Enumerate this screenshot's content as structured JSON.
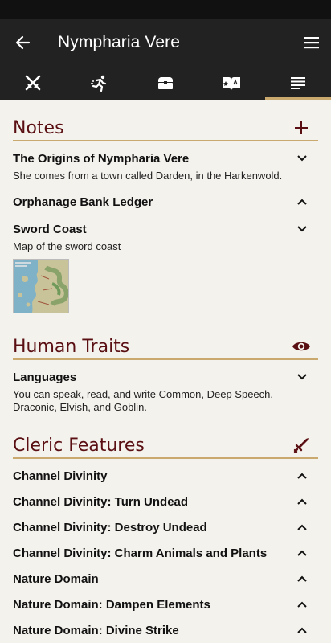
{
  "header": {
    "title": "Nympharia Vere"
  },
  "tabs": [
    {
      "icon": "crossed-swords-icon"
    },
    {
      "icon": "running-person-icon"
    },
    {
      "icon": "treasure-chest-icon"
    },
    {
      "icon": "spellbook-icon"
    },
    {
      "icon": "notes-lines-icon",
      "active": true
    }
  ],
  "notes": {
    "title": "Notes",
    "items": [
      {
        "title": "The Origins of Nympharia Vere",
        "body": "She comes from a town called Darden, in the Harkenwold.",
        "expanded": true
      },
      {
        "title": "Orphanage Bank Ledger",
        "expanded": false
      },
      {
        "title": "Sword Coast",
        "body": "Map of the sword coast",
        "expanded": true
      }
    ]
  },
  "traits": {
    "title": "Human Traits",
    "items": [
      {
        "title": "Languages",
        "body": "You can speak, read, and write Common, Deep Speech, Draconic, Elvish, and Goblin."
      }
    ]
  },
  "features": {
    "title": "Cleric Features",
    "items": [
      {
        "title": "Channel Divinity"
      },
      {
        "title": "Channel Divinity: Turn Undead"
      },
      {
        "title": "Channel Divinity: Destroy Undead"
      },
      {
        "title": "Channel Divinity: Charm Animals and Plants"
      },
      {
        "title": "Nature Domain"
      },
      {
        "title": "Nature Domain: Dampen Elements"
      },
      {
        "title": "Nature Domain: Divine Strike"
      }
    ]
  },
  "colors": {
    "accent": "#5a0f12",
    "gold": "#c9a96e",
    "bar": "#222222",
    "background": "#f4f2ed"
  }
}
